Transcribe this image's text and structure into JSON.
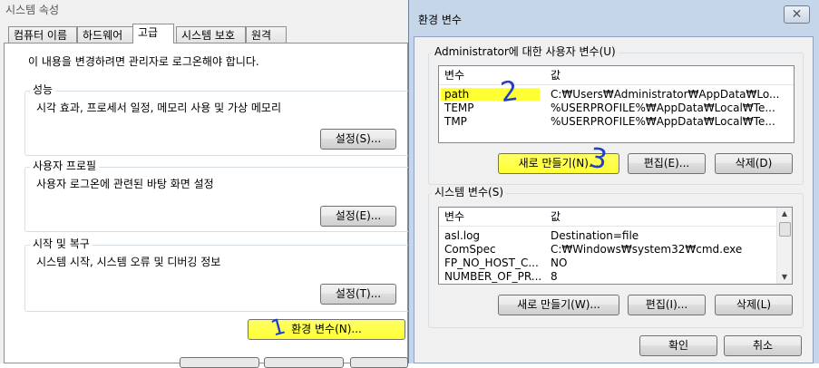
{
  "system_properties": {
    "title": "시스템 속성",
    "tabs": [
      "컴퓨터 이름",
      "하드웨어",
      "고급",
      "시스템 보호",
      "원격"
    ],
    "active_tab": "고급",
    "admin_notice": "이 내용을 변경하려면 관리자로 로그온해야 합니다.",
    "groups": [
      {
        "title": "성능",
        "description": "시각 효과, 프로세서 일정, 메모리 사용 및 가상 메모리",
        "button": "설정(S)..."
      },
      {
        "title": "사용자 프로필",
        "description": "사용자 로그온에 관련된 바탕 화면 설정",
        "button": "설정(E)..."
      },
      {
        "title": "시작 및 복구",
        "description": "시스템 시작, 시스템 오류 및 디버깅 정보",
        "button": "설정(T)..."
      }
    ],
    "env_button": "환경 변수(N)..."
  },
  "env_vars": {
    "title": "환경 변수",
    "close_symbol": "✕",
    "user_section_title": "Administrator에 대한 사용자 변수(U)",
    "columns": [
      "변수",
      "값"
    ],
    "user_vars": [
      {
        "name": "path",
        "value": "C:₩Users₩Administrator₩AppData₩Lo..."
      },
      {
        "name": "TEMP",
        "value": "%USERPROFILE%₩AppData₩Local₩Te..."
      },
      {
        "name": "TMP",
        "value": "%USERPROFILE%₩AppData₩Local₩Te..."
      }
    ],
    "user_buttons": [
      "새로 만들기(N)...",
      "편집(E)...",
      "삭제(D)"
    ],
    "system_section_title": "시스템 변수(S)",
    "system_vars": [
      {
        "name": "asl.log",
        "value": "Destination=file"
      },
      {
        "name": "ComSpec",
        "value": "C:₩Windows₩system32₩cmd.exe"
      },
      {
        "name": "FP_NO_HOST_C...",
        "value": "NO"
      },
      {
        "name": "NUMBER_OF_PR...",
        "value": "8"
      }
    ],
    "system_buttons": [
      "새로 만들기(W)...",
      "편집(I)...",
      "삭제(L)"
    ],
    "ok_button": "확인",
    "cancel_button": "취소"
  },
  "annotations": [
    "1",
    "2",
    "3"
  ],
  "colors": {
    "highlight": "#ffff33",
    "annotation": "#1f3fc4"
  }
}
